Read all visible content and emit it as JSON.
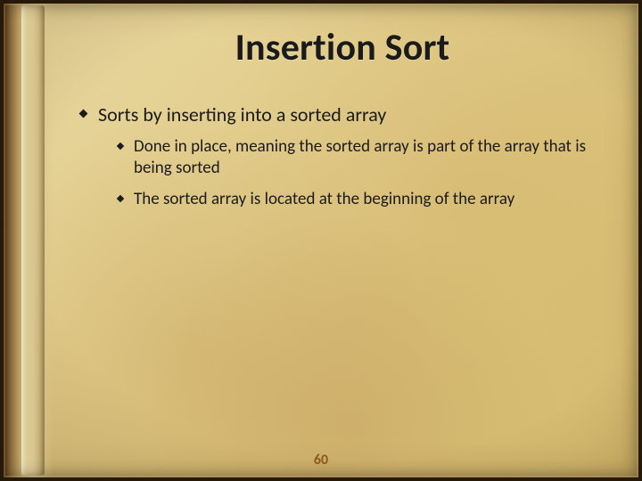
{
  "title": "Insertion Sort",
  "bullets": {
    "top": "Sorts by inserting into a sorted array",
    "sub1": "Done in place, meaning the sorted array is part of the array that is being sorted",
    "sub2": "The sorted array is located at the beginning of the array"
  },
  "page_number": "60"
}
